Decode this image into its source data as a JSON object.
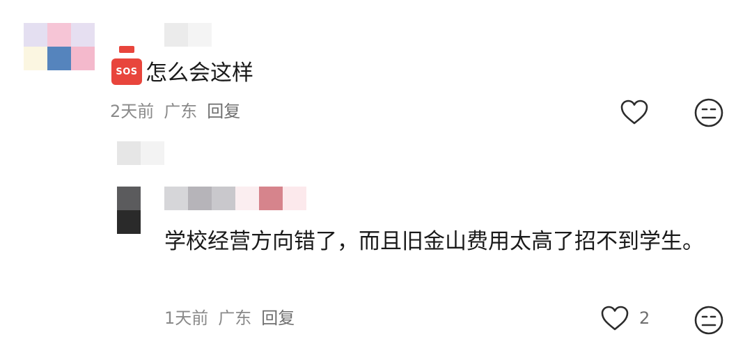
{
  "comments": [
    {
      "avatar_colors": [
        "#e4dff1",
        "#f6c5d6",
        "#e6dff1",
        "#fbf6e1",
        "#5584bd",
        "#f4b9cc"
      ],
      "username_blur_colors": [
        "#ebebeb",
        "#f4f4f4"
      ],
      "emoji_label": "SOS",
      "text": "怎么会这样",
      "time": "2天前",
      "location": "广东",
      "reply_label": "回复",
      "like_count": "",
      "like_icon": "heart-outline-icon",
      "dislike_icon": "neutral-face-icon"
    },
    {
      "reply_to_blur_colors": [
        "#e6e6e6",
        "#f3f3f3"
      ],
      "avatar_colors": [
        "#5b5b5d",
        "#2a2a2a"
      ],
      "username_blur_colors": [
        "#d6d6d9",
        "#b6b4b9",
        "#c9c8cc",
        "#fbeef0",
        "#d6848c",
        "#fce9ec"
      ],
      "text": "学校经营方向错了，而且旧金山费用太高了招不到学生。",
      "time": "1天前",
      "location": "广东",
      "reply_label": "回复",
      "like_count": "2",
      "like_icon": "heart-outline-icon",
      "dislike_icon": "neutral-face-icon"
    }
  ]
}
